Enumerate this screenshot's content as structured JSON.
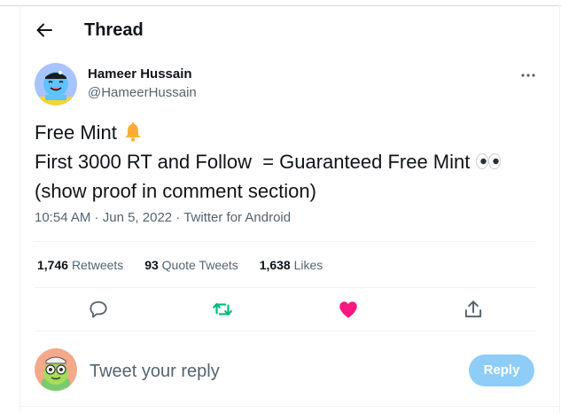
{
  "header": {
    "title": "Thread"
  },
  "tweet": {
    "author": {
      "display_name": "Hameer Hussain",
      "handle": "@HameerHussain"
    },
    "text_lines": [
      "Free Mint",
      "First 3000 RT and Follow  = Guaranteed Free Mint",
      "(show proof in comment section)"
    ],
    "emojis": [
      "bell-emoji",
      "eyes-emoji"
    ],
    "time": "10:54 AM",
    "date": "Jun 5, 2022",
    "source": "Twitter for Android",
    "stats": {
      "retweets_count": "1,746",
      "retweets_label": "Retweets",
      "quotes_count": "93",
      "quotes_label": "Quote Tweets",
      "likes_count": "1,638",
      "likes_label": "Likes"
    }
  },
  "actions": {
    "icons": [
      "reply-icon",
      "retweet-icon",
      "like-icon",
      "share-icon"
    ],
    "colors": {
      "retweet": "#00ba7c",
      "like": "#f91880",
      "default": "#536471"
    }
  },
  "reply": {
    "placeholder": "Tweet your reply",
    "button_label": "Reply"
  }
}
